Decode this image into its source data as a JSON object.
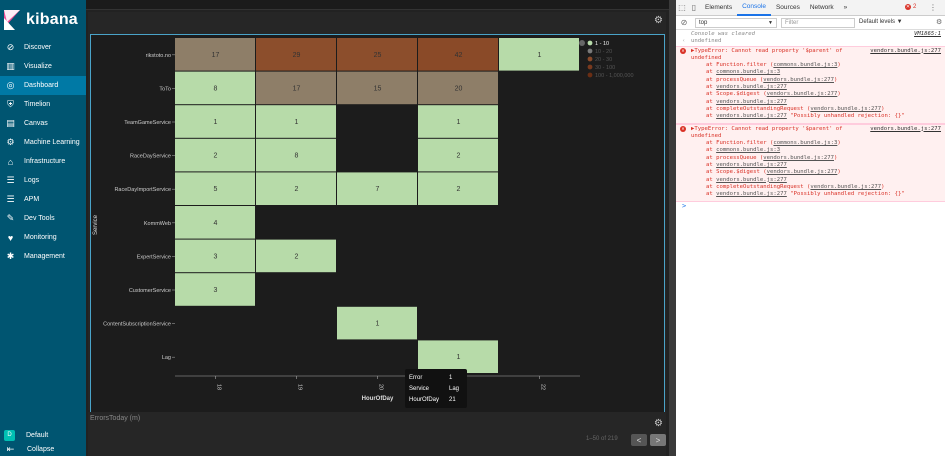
{
  "brand": {
    "name": "kibana"
  },
  "sidebar": {
    "items": [
      {
        "label": "Discover",
        "icon": "compass-icon"
      },
      {
        "label": "Visualize",
        "icon": "bar-chart-icon"
      },
      {
        "label": "Dashboard",
        "icon": "dashboard-icon",
        "active": true
      },
      {
        "label": "Timelion",
        "icon": "shield-icon"
      },
      {
        "label": "Canvas",
        "icon": "canvas-icon"
      },
      {
        "label": "Machine Learning",
        "icon": "ml-icon"
      },
      {
        "label": "Infrastructure",
        "icon": "infrastructure-icon"
      },
      {
        "label": "Logs",
        "icon": "logs-icon"
      },
      {
        "label": "APM",
        "icon": "apm-icon"
      },
      {
        "label": "Dev Tools",
        "icon": "wrench-icon"
      },
      {
        "label": "Monitoring",
        "icon": "heart-icon"
      },
      {
        "label": "Management",
        "icon": "gear-icon"
      }
    ],
    "space": {
      "badge": "D",
      "label": "Default"
    },
    "collapse": "Collapse"
  },
  "chart_data": {
    "type": "heatmap",
    "xlabel": "HourOfDay",
    "ylabel": "Service",
    "x_ticks": [
      "18",
      "19",
      "20",
      "21",
      "22"
    ],
    "y_categories": [
      "rikstoto.no",
      "ToTo",
      "TeamGameService",
      "RaceDayService",
      "RaceDayImportService",
      "KommWeb",
      "ExpertService",
      "CustomerService",
      "ContentSubscriptionService",
      "Lag"
    ],
    "cells": [
      {
        "row": "rikstoto.no",
        "x": "18",
        "value": 17
      },
      {
        "row": "rikstoto.no",
        "x": "19",
        "value": 29
      },
      {
        "row": "rikstoto.no",
        "x": "20",
        "value": 25
      },
      {
        "row": "rikstoto.no",
        "x": "21",
        "value": 42
      },
      {
        "row": "rikstoto.no",
        "x": "22",
        "value": 1
      },
      {
        "row": "ToTo",
        "x": "18",
        "value": 8
      },
      {
        "row": "ToTo",
        "x": "19",
        "value": 17
      },
      {
        "row": "ToTo",
        "x": "20",
        "value": 15
      },
      {
        "row": "ToTo",
        "x": "21",
        "value": 20
      },
      {
        "row": "TeamGameService",
        "x": "18",
        "value": 1
      },
      {
        "row": "TeamGameService",
        "x": "19",
        "value": 1
      },
      {
        "row": "TeamGameService",
        "x": "21",
        "value": 1
      },
      {
        "row": "RaceDayService",
        "x": "18",
        "value": 2
      },
      {
        "row": "RaceDayService",
        "x": "19",
        "value": 8
      },
      {
        "row": "RaceDayService",
        "x": "21",
        "value": 2
      },
      {
        "row": "RaceDayImportService",
        "x": "18",
        "value": 5
      },
      {
        "row": "RaceDayImportService",
        "x": "19",
        "value": 2
      },
      {
        "row": "RaceDayImportService",
        "x": "20",
        "value": 7
      },
      {
        "row": "RaceDayImportService",
        "x": "21",
        "value": 2
      },
      {
        "row": "KommWeb",
        "x": "18",
        "value": 4
      },
      {
        "row": "ExpertService",
        "x": "18",
        "value": 3
      },
      {
        "row": "ExpertService",
        "x": "19",
        "value": 2
      },
      {
        "row": "CustomerService",
        "x": "18",
        "value": 3
      },
      {
        "row": "ContentSubscriptionService",
        "x": "20",
        "value": 1
      },
      {
        "row": "Lag",
        "x": "21",
        "value": 1
      }
    ],
    "legend": [
      {
        "label": "1 - 10",
        "color": "#b7dba9",
        "active": true
      },
      {
        "label": "10 - 20",
        "color": "#7a7a7a",
        "active": false
      },
      {
        "label": "20 - 30",
        "color": "#8a4a2a",
        "active": false
      },
      {
        "label": "30 - 100",
        "color": "#7a3a1e",
        "active": false
      },
      {
        "label": "100 - 1,000,000",
        "color": "#6a2e14",
        "active": false
      }
    ],
    "legend_placement": "top-right",
    "grid": false
  },
  "colors": {
    "range_1_10": "#b7dba9",
    "range_10_20": "#8e7e68",
    "range_20_30": "#8c4e2c",
    "range_30_100": "#8a4a28"
  },
  "tooltip": {
    "rows": [
      {
        "key": "Error",
        "value": "1"
      },
      {
        "key": "Service",
        "value": "Lag"
      },
      {
        "key": "HourOfDay",
        "value": "21"
      }
    ]
  },
  "panel2": {
    "title": "ErrorsToday (m)",
    "pager": "1–50 of 219",
    "prev": "<",
    "next": ">"
  },
  "devtools": {
    "tabs": [
      "Elements",
      "Console",
      "Sources",
      "Network",
      "»"
    ],
    "active_tab": "Console",
    "error_count": "2",
    "context": "top",
    "filter_placeholder": "Filter",
    "levels": "Default levels ▼",
    "console": {
      "cleared": "Console was cleared",
      "cleared_src": "VM1865:1",
      "undefined": "undefined",
      "errors": [
        {
          "head": "▶TypeError: Cannot read property '$parent' of",
          "head_src": "vendors.bundle.js:277",
          "sub": "undefined",
          "stack": [
            {
              "pre": "at Function.filter (",
              "link": "commons.bundle.js:3",
              "post": ")"
            },
            {
              "pre": "at ",
              "link": "commons.bundle.js:3",
              "post": ""
            },
            {
              "pre": "at processQueue (",
              "link": "vendors.bundle.js:277",
              "post": ")"
            },
            {
              "pre": "at ",
              "link": "vendors.bundle.js:277",
              "post": ""
            },
            {
              "pre": "at Scope.$digest (",
              "link": "vendors.bundle.js:277",
              "post": ")"
            },
            {
              "pre": "at ",
              "link": "vendors.bundle.js:277",
              "post": ""
            },
            {
              "pre": "at completeOutstandingRequest (",
              "link": "vendors.bundle.js:277",
              "post": ")"
            },
            {
              "pre": "at ",
              "link": "vendors.bundle.js:277",
              "post": " \"Possibly unhandled rejection: {}\""
            }
          ]
        },
        {
          "head": "▶TypeError: Cannot read property '$parent' of",
          "head_src": "vendors.bundle.js:277",
          "sub": "undefined",
          "stack": [
            {
              "pre": "at Function.filter (",
              "link": "commons.bundle.js:3",
              "post": ")"
            },
            {
              "pre": "at ",
              "link": "commons.bundle.js:3",
              "post": ""
            },
            {
              "pre": "at processQueue (",
              "link": "vendors.bundle.js:277",
              "post": ")"
            },
            {
              "pre": "at ",
              "link": "vendors.bundle.js:277",
              "post": ""
            },
            {
              "pre": "at Scope.$digest (",
              "link": "vendors.bundle.js:277",
              "post": ")"
            },
            {
              "pre": "at ",
              "link": "vendors.bundle.js:277",
              "post": ""
            },
            {
              "pre": "at completeOutstandingRequest (",
              "link": "vendors.bundle.js:277",
              "post": ")"
            },
            {
              "pre": "at ",
              "link": "vendors.bundle.js:277",
              "post": " \"Possibly unhandled rejection: {}\""
            }
          ]
        }
      ],
      "prompt": ">"
    }
  }
}
